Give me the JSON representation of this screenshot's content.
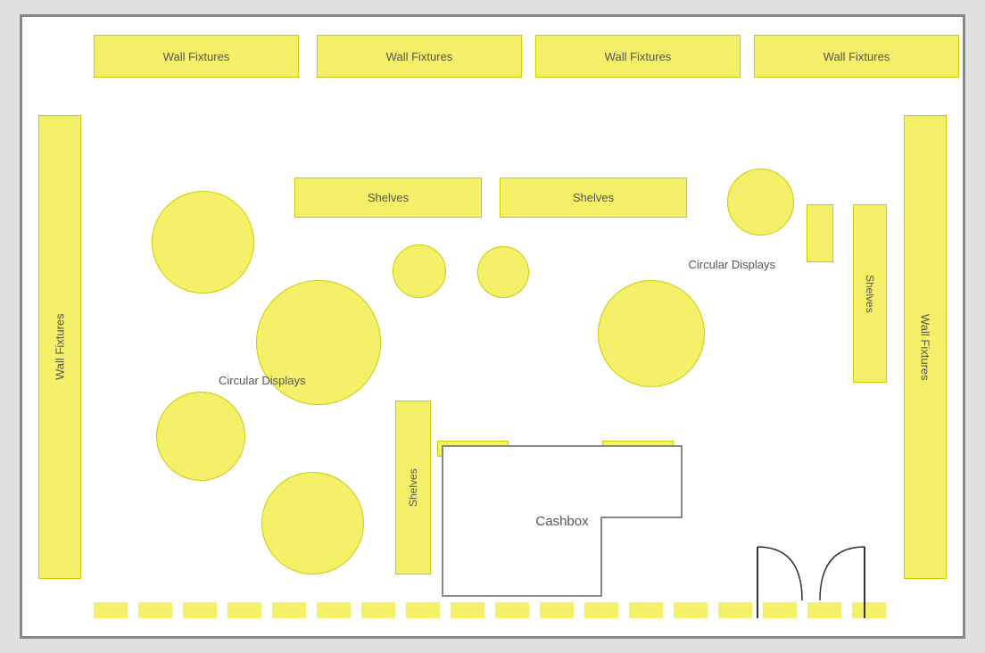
{
  "labels": {
    "wall_fixtures": "Wall Fixtures",
    "shelves": "Shelves",
    "circular_displays": "Circular Displays",
    "cashbox": "Cashbox",
    "wall_fixtures_right": "Wall Fixtures"
  },
  "top_fixtures": [
    {
      "id": "wf-top-1",
      "label": "Wall Fixtures"
    },
    {
      "id": "wf-top-2",
      "label": "Wall Fixtures"
    },
    {
      "id": "wf-top-3",
      "label": "Wall Fixtures"
    },
    {
      "id": "wf-top-4",
      "label": "Wall Fixtures"
    }
  ]
}
